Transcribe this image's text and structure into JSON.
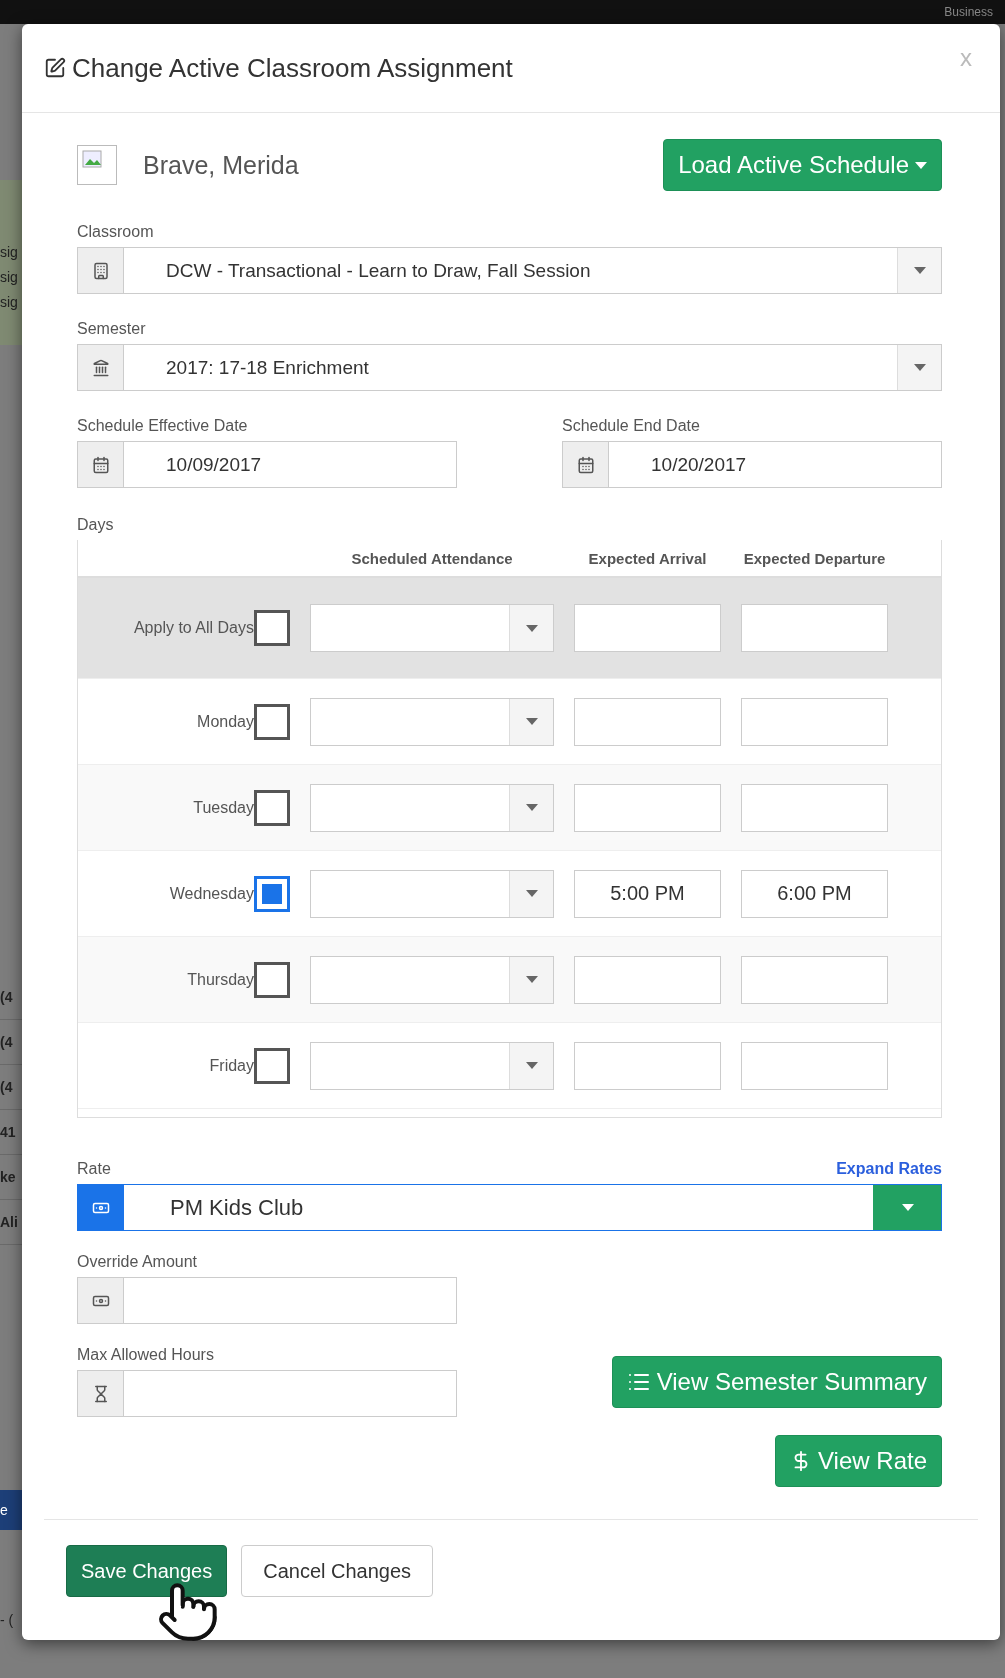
{
  "background": {
    "top_bar_text": "Business",
    "panel_fragments": [
      "sig",
      "sig",
      "sig"
    ],
    "row_fragments": [
      "(4",
      "(4",
      "(4",
      "41",
      "ke",
      "Ali"
    ],
    "blue_bar_fragment": "e",
    "footer_fragment": "- ("
  },
  "modal": {
    "title": "Change Active Classroom Assignment",
    "close": "x",
    "student": "Brave, Merida",
    "load_button": "Load Active Schedule",
    "classroom": {
      "label": "Classroom",
      "value": "DCW - Transactional - Learn to Draw, Fall Session",
      "focused": false
    },
    "semester": {
      "label": "Semester",
      "value": "2017: 17-18 Enrichment",
      "focused": false
    },
    "effective_date": {
      "label": "Schedule Effective Date",
      "value": "10/09/2017"
    },
    "end_date": {
      "label": "Schedule End Date",
      "value": "10/20/2017"
    },
    "days": {
      "label": "Days",
      "columns": [
        "Scheduled Attendance",
        "Expected Arrival",
        "Expected Departure"
      ],
      "rows": [
        {
          "kind": "all",
          "label": "Apply to All Days",
          "checked": false
        },
        {
          "kind": "day",
          "label": "Monday",
          "checked": false
        },
        {
          "kind": "day",
          "label": "Tuesday",
          "checked": false
        },
        {
          "kind": "day",
          "label": "Wednesday",
          "checked": true,
          "arrival": "5:00 PM",
          "departure": "6:00 PM"
        },
        {
          "kind": "day",
          "label": "Thursday",
          "checked": false
        },
        {
          "kind": "day",
          "label": "Friday",
          "checked": false
        }
      ]
    },
    "rate": {
      "label": "Rate",
      "link": "Expand Rates",
      "value": "PM Kids Club",
      "focused": true
    },
    "override": {
      "label": "Override Amount"
    },
    "max_hours": {
      "label": "Max Allowed Hours"
    },
    "summary_button": "View Semester Summary",
    "rate_button": "View Rate",
    "save_button": "Save Changes",
    "cancel_button": "Cancel Changes"
  }
}
